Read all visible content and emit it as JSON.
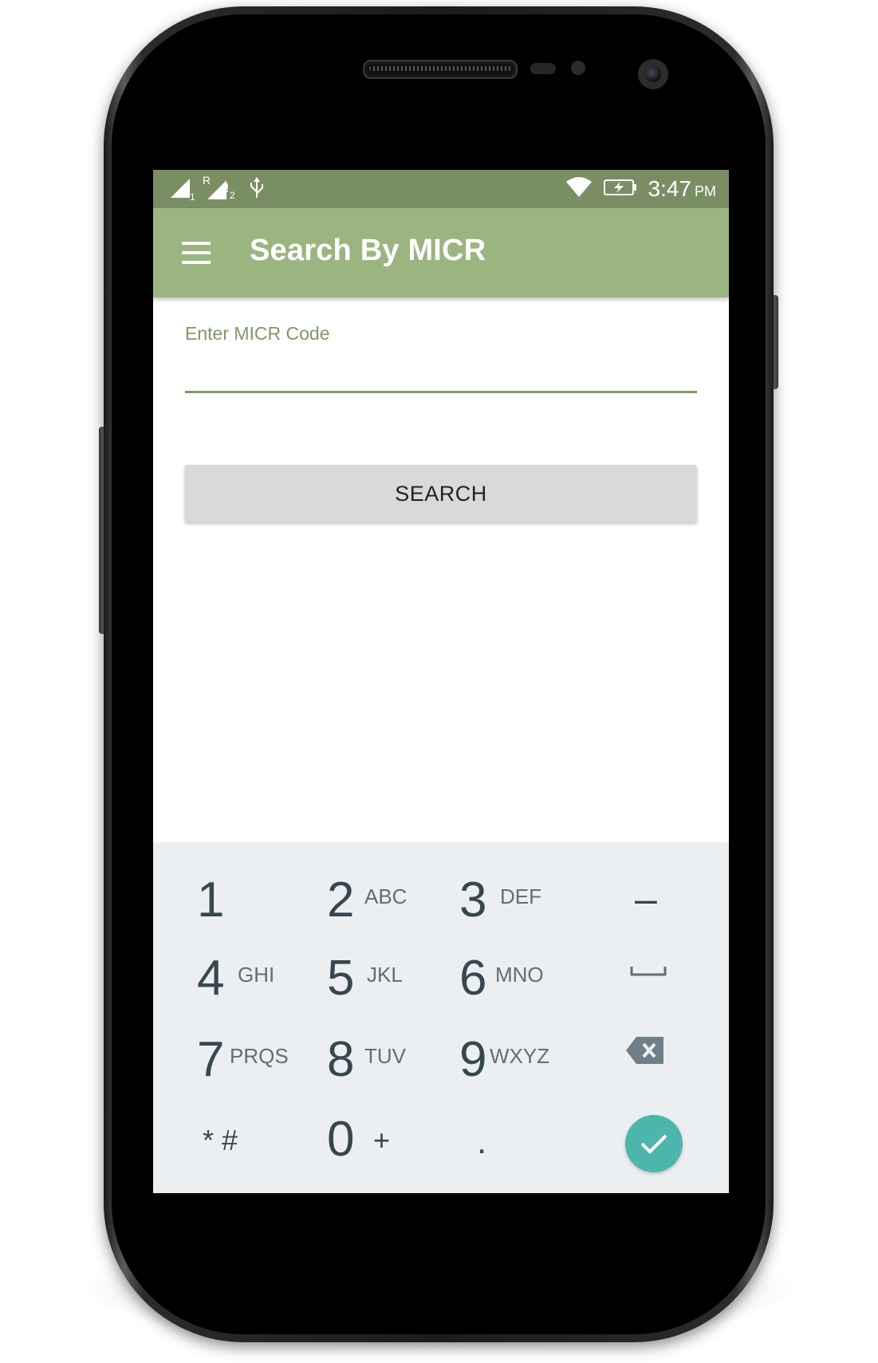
{
  "status_bar": {
    "time": "3:47",
    "ampm": "PM",
    "sim1_label": "1",
    "sim2_roaming": "R",
    "sim2_label": "2",
    "icons": [
      "signal-sim1-icon",
      "signal-sim2-roaming-icon",
      "usb-icon",
      "wifi-icon",
      "battery-charging-icon"
    ]
  },
  "app_bar": {
    "title": "Search By MICR",
    "menu_icon": "hamburger-menu-icon"
  },
  "form": {
    "micr_label": "Enter MICR Code",
    "micr_value": "",
    "search_button": "SEARCH"
  },
  "keyboard": {
    "keys": [
      {
        "digit": "1",
        "letters": ""
      },
      {
        "digit": "2",
        "letters": "ABC"
      },
      {
        "digit": "3",
        "letters": "DEF"
      },
      {
        "symbol": "–"
      },
      {
        "digit": "4",
        "letters": "GHI"
      },
      {
        "digit": "5",
        "letters": "JKL"
      },
      {
        "digit": "6",
        "letters": "MNO"
      },
      {
        "symbol": "space"
      },
      {
        "digit": "7",
        "letters": "PRQS"
      },
      {
        "digit": "8",
        "letters": "TUV"
      },
      {
        "digit": "9",
        "letters": "WXYZ"
      },
      {
        "symbol": "backspace"
      },
      {
        "symbol": "* #"
      },
      {
        "digit": "0",
        "letters": "+"
      },
      {
        "symbol": "."
      },
      {
        "symbol": "done"
      }
    ]
  },
  "colors": {
    "status_bar": "#7a8e63",
    "app_bar": "#9bb581",
    "accent": "#7e9966",
    "keyboard_bg": "#eceff1",
    "done_button": "#4db6ac"
  }
}
